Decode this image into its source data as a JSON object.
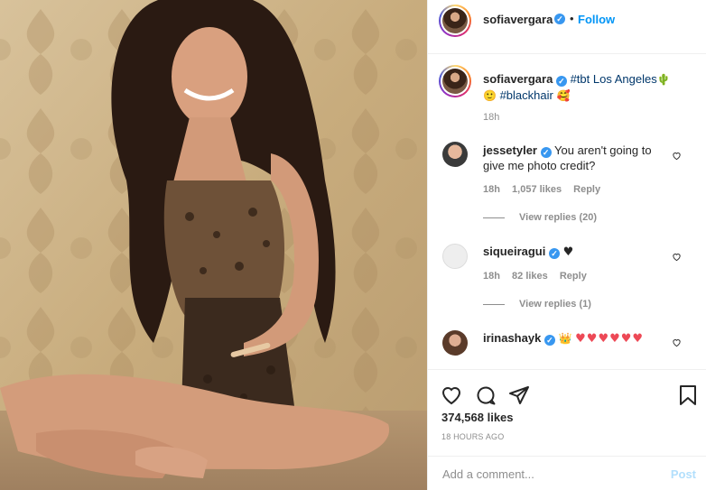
{
  "photo": {
    "alt_subject": "woman seated on floor against damask wallpaper"
  },
  "header": {
    "username": "sofiavergara",
    "verified_mark": "✓",
    "separator": "•",
    "follow_label": "Follow"
  },
  "caption": {
    "username": "sofiavergara",
    "text_part1": "#tbt Los Angeles",
    "emoji_cactus": "🌵",
    "emoji_smile": "🙂",
    "hashtag2": "#blackhair",
    "emoji_face": "🥰",
    "time": "18h"
  },
  "comments": [
    {
      "username": "jessetyler",
      "text": "You aren't going to give me photo credit?",
      "time": "18h",
      "likes": "1,057 likes",
      "reply_label": "Reply",
      "view_replies": "View replies (20)"
    },
    {
      "username": "siqueiragui",
      "text": "♥",
      "time": "18h",
      "likes": "82 likes",
      "reply_label": "Reply",
      "view_replies": "View replies (1)"
    },
    {
      "username": "irinashayk",
      "crown": "👑",
      "hearts": "♥♥♥♥♥♥"
    }
  ],
  "actions": {
    "likes": "374,568 likes",
    "timestamp": "18 HOURS AGO"
  },
  "add_comment": {
    "placeholder": "Add a comment...",
    "post_label": "Post"
  },
  "colors": {
    "link_blue": "#0095f6",
    "verified_blue": "#3897f0",
    "muted": "#8e8e8e",
    "heart_red": "#ed4956"
  }
}
